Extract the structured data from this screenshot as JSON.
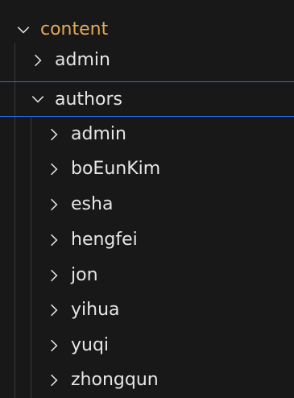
{
  "explorer": {
    "root": {
      "label": "content",
      "expanded": true,
      "icon": "chevron-down-icon"
    },
    "items": [
      {
        "label": "admin",
        "expanded": false,
        "icon": "chevron-right-icon"
      },
      {
        "label": "authors",
        "expanded": true,
        "icon": "chevron-down-icon",
        "children": [
          {
            "label": "admin",
            "icon": "chevron-right-icon"
          },
          {
            "label": "boEunKim",
            "icon": "chevron-right-icon"
          },
          {
            "label": "esha",
            "icon": "chevron-right-icon"
          },
          {
            "label": "hengfei",
            "icon": "chevron-right-icon"
          },
          {
            "label": "jon",
            "icon": "chevron-right-icon"
          },
          {
            "label": "yihua",
            "icon": "chevron-right-icon"
          },
          {
            "label": "yuqi",
            "icon": "chevron-right-icon"
          },
          {
            "label": "zhongqun",
            "icon": "chevron-right-icon"
          }
        ]
      }
    ]
  },
  "colors": {
    "background": "#181818",
    "text": "#e6e6e6",
    "root_folder_text": "#e2a85a",
    "focus_border": "#1f6feb"
  }
}
